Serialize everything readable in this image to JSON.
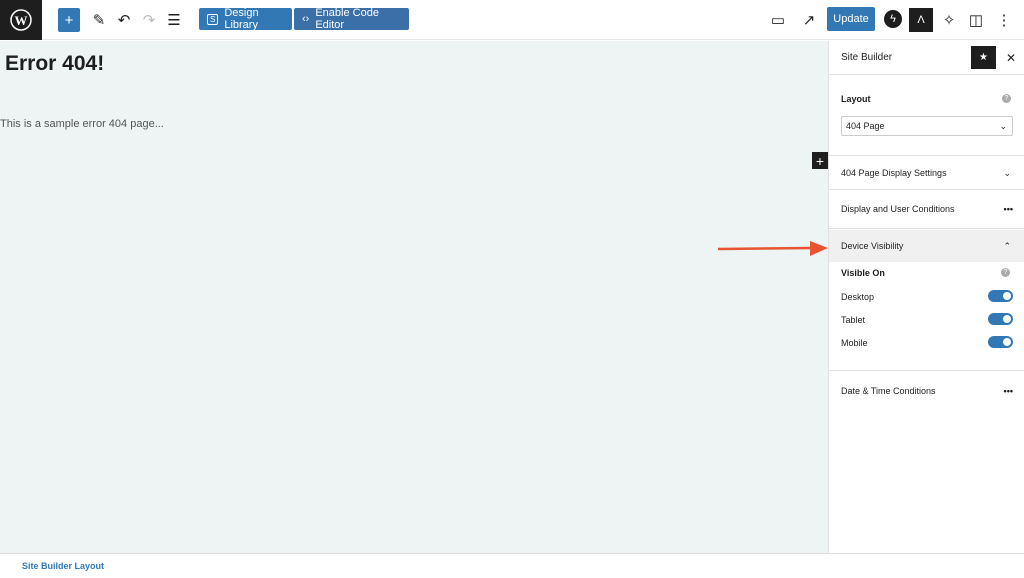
{
  "toolbar": {
    "design_library": "Design Library",
    "code_editor": "Enable Code Editor",
    "update": "Update"
  },
  "canvas": {
    "title": "Error 404!",
    "text": "This is a sample error 404 page..."
  },
  "sidebar": {
    "title": "Site Builder",
    "layout_label": "Layout",
    "layout_value": "404 Page",
    "sections": [
      "404 Page Display Settings",
      "Display and User Conditions",
      "Device Visibility",
      "Date & Time Conditions"
    ],
    "visible_on": "Visible On",
    "devices": [
      {
        "label": "Desktop",
        "on": true
      },
      {
        "label": "Tablet",
        "on": true
      },
      {
        "label": "Mobile",
        "on": true
      }
    ]
  },
  "footer": {
    "label": "Site Builder Layout"
  },
  "colors": {
    "accent": "#3178b5",
    "arrow": "#e8542f"
  }
}
